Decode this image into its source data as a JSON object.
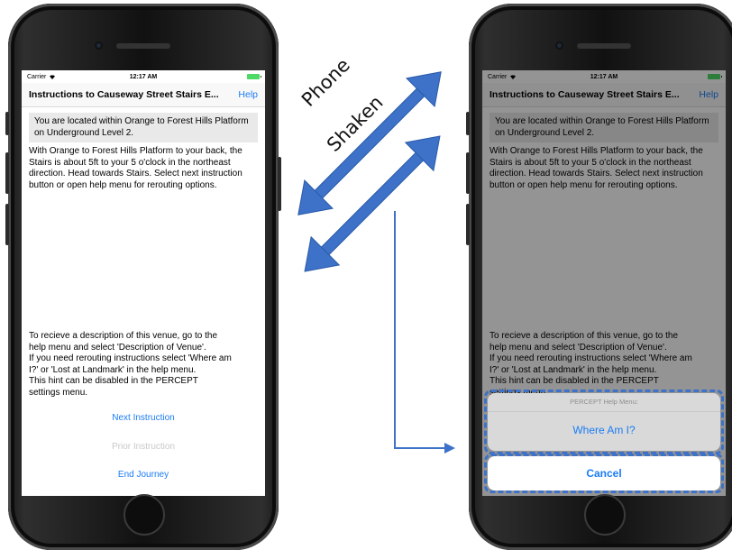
{
  "colors": {
    "accent": "#1a7cf5",
    "arrow": "#3d72c8",
    "disabled": "#c8c8c8",
    "battery": "#4cd964"
  },
  "status_bar": {
    "carrier": "Carrier",
    "time": "12:17 AM"
  },
  "nav": {
    "title": "Instructions to Causeway Street Stairs E...",
    "help": "Help"
  },
  "location": "You are located within Orange to Forest Hills Platform on Underground Level 2.",
  "instruction": "With Orange to Forest Hills Platform to your back, the Stairs is about 5ft to your 5 o'clock in the northeast direction.  Head towards Stairs.  Select next instruction button or open help menu for rerouting options.",
  "hint_lines": [
    "To recieve a description of this venue, go to the",
    "help menu and select 'Description of Venue'.",
    "If you need rerouting instructions select 'Where am",
    "I?' or 'Lost at Landmark' in the help menu.",
    "This hint can be disabled in the PERCEPT",
    "settings menu."
  ],
  "buttons": {
    "next": "Next Instruction",
    "prior": "Prior Instruction",
    "end": "End Journey"
  },
  "help_menu": {
    "title": "PERCEPT Help Menu:",
    "option": "Where Am I?",
    "cancel": "Cancel"
  },
  "annotation": {
    "line1": "Phone",
    "line2": "Shaken"
  },
  "icons": {
    "wifi": "wifi-icon",
    "battery": "battery-icon",
    "arrow_up": "double-arrow-icon",
    "arrow_down": "double-arrow-icon",
    "pointer": "pointer-arrow-icon"
  }
}
